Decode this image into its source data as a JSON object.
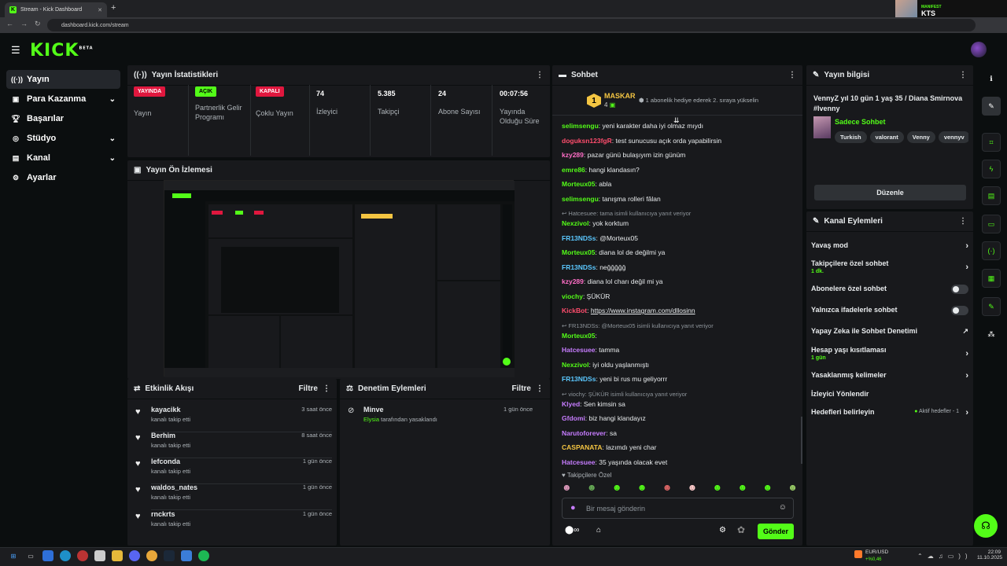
{
  "browser": {
    "tab_title": "Stream - Kick Dashboard",
    "url": "dashboard.kick.com/stream",
    "now_playing_label": "MANIFEST",
    "now_playing_name": "KTS"
  },
  "brand": {
    "logo": "KICK",
    "beta": "BETA",
    "accent": "#53fc18"
  },
  "sidebar": {
    "items": [
      {
        "label": "Yayın",
        "icon": "broadcast-icon"
      },
      {
        "label": "Para Kazanma",
        "icon": "money-icon"
      },
      {
        "label": "Başarılar",
        "icon": "trophy-icon"
      },
      {
        "label": "Stüdyo",
        "icon": "studio-icon"
      },
      {
        "label": "Kanal",
        "icon": "channel-icon"
      },
      {
        "label": "Ayarlar",
        "icon": "gear-icon"
      }
    ]
  },
  "stats": {
    "title": "Yayın İstatistikleri",
    "items": [
      {
        "badge": "YAYINDA",
        "label": "Yayın"
      },
      {
        "badge": "AÇIK",
        "label": "Partnerlik Gelir Programı"
      },
      {
        "badge": "KAPALI",
        "label": "Çoklu Yayın"
      },
      {
        "value": "74",
        "label": "İzleyici"
      },
      {
        "value": "5.385",
        "label": "Takipçi"
      },
      {
        "value": "24",
        "label": "Abone Sayısı"
      },
      {
        "value": "00:07:56",
        "label": "Yayında Olduğu Süre"
      }
    ]
  },
  "preview": {
    "title": "Yayın Ön İzlemesi"
  },
  "activity": {
    "title": "Etkinlik Akışı",
    "filter": "Filtre",
    "items": [
      {
        "name": "kayacikk",
        "sub": "kanalı takip etti",
        "time": "3 saat önce"
      },
      {
        "name": "Berhim",
        "sub": "kanalı takip etti",
        "time": "8 saat önce"
      },
      {
        "name": "lefconda",
        "sub": "kanalı takip etti",
        "time": "1 gün önce"
      },
      {
        "name": "waldos_nates",
        "sub": "kanalı takip etti",
        "time": "1 gün önce"
      },
      {
        "name": "rnckrts",
        "sub": "kanalı takip etti",
        "time": "1 gün önce"
      }
    ]
  },
  "moderation": {
    "title": "Denetim Eylemleri",
    "filter": "Filtre",
    "item": {
      "name": "Minve",
      "actor": "Elysia",
      "action": "tarafından yasaklandı",
      "time": "1 gün önce"
    }
  },
  "chat": {
    "title": "Sohbet",
    "pinned_name": "MASKAR",
    "pinned_count": "4",
    "pinned_rank": "1",
    "pinned_text": "1 abonelik hediye ederek 2. sıraya yükselin",
    "messages": [
      {
        "user": "selimsengu",
        "color": "#53fc18",
        "text": "yeni karakter daha iyi olmaz mıydı"
      },
      {
        "user": "doguksn123fgR",
        "color": "#ff4d6d",
        "text": "test sunucusu açık orda yapabilirsin"
      },
      {
        "user": "kzy289",
        "color": "#ff6ec7",
        "text": "pazar günü bulaşıyım izin günüm"
      },
      {
        "user": "emre86",
        "color": "#53fc18",
        "text": "hangi klandasın?"
      },
      {
        "user": "Morteux05",
        "color": "#53fc18",
        "text": "abla"
      },
      {
        "user": "selimsengu",
        "color": "#53fc18",
        "text": "tanışma rolleri fâlan"
      },
      {
        "reply": "Hatcesuee: tama isimli kullanıcıya yanıt veriyor"
      },
      {
        "user": "Nexzivol",
        "color": "#53fc18",
        "text": "yok korktum"
      },
      {
        "user": "FR13NDSs",
        "color": "#5bc8ff",
        "text": "@Morteux05"
      },
      {
        "user": "Morteux05",
        "color": "#53fc18",
        "text": "diana lol de değilmi ya"
      },
      {
        "user": "FR13NDSs",
        "color": "#5bc8ff",
        "text": "neğğğğğ"
      },
      {
        "user": "kzy289",
        "color": "#ff6ec7",
        "text": "diana lol charı değil mi ya"
      },
      {
        "user": "viochy",
        "color": "#53fc18",
        "text": "ŞÜKÜR"
      },
      {
        "user": "KickBot",
        "color": "#ff4d6d",
        "text": "https://www.instagram.com/dllosinn"
      },
      {
        "reply": "FR13NDSs: @Morteux05 isimli kullanıcıya yanıt veriyor"
      },
      {
        "user": "Morteux05",
        "color": "#53fc18",
        "text": ""
      },
      {
        "user": "Hatcesuee",
        "color": "#c77dff",
        "text": "tamma"
      },
      {
        "user": "Nexzivol",
        "color": "#53fc18",
        "text": "iyi oldu yaşlanmıştı"
      },
      {
        "user": "FR13NDSs",
        "color": "#5bc8ff",
        "text": "yeni bi rus mu geliyorrr"
      },
      {
        "reply": "viochy: ŞÜKÜR isimli kullanıcıya yanıt veriyor"
      },
      {
        "user": "Klyed",
        "color": "#c77dff",
        "text": "Sen kimsin sa"
      },
      {
        "user": "Gfdomi",
        "color": "#c77dff",
        "text": "biz hangi klandayız"
      },
      {
        "user": "Narutoforever",
        "color": "#c77dff",
        "text": "sa"
      },
      {
        "user": "CASPANATA",
        "color": "#f4c542",
        "text": "lazımdı yeni char"
      },
      {
        "user": "Hatcesuee",
        "color": "#c77dff",
        "text": "35 yaşında olacak evet"
      }
    ],
    "emote_section": "Takipçilere Özel",
    "input_placeholder": "Bir mesaj gönderin",
    "send_label": "Gönder"
  },
  "stream_info": {
    "title": "Yayın bilgisi",
    "stream_title": "VennyZ yıl 10 gün 1 yaş 35 / Diana Smirnova #Ivenny",
    "category": "Sadece Sohbet",
    "tags": [
      "Turkish",
      "valorant",
      "Venny",
      "vennyv"
    ],
    "edit_label": "Düzenle"
  },
  "channel_actions": {
    "title": "Kanal Eylemleri",
    "items": [
      {
        "label": "Yavaş mod",
        "control": "arrow"
      },
      {
        "label": "Takipçilere özel sohbet",
        "sub": "1 dk.",
        "control": "arrow"
      },
      {
        "label": "Abonelere özel sohbet",
        "control": "toggle"
      },
      {
        "label": "Yalnızca ifadelerle sohbet",
        "control": "toggle"
      },
      {
        "label": "Yapay Zeka ile Sohbet Denetimi",
        "control": "external"
      },
      {
        "label": "Hesap yaşı kısıtlaması",
        "sub": "1 gün",
        "control": "arrow"
      },
      {
        "label": "Yasaklanmış kelimeler",
        "control": "arrow"
      },
      {
        "label": "İzleyici Yönlendir",
        "control": "none"
      },
      {
        "label": "Hedefleri belirleyin",
        "status": "Aktif hedefler - 1",
        "control": "arrow"
      }
    ]
  },
  "taskbar": {
    "ticker_name": "EUR/USD",
    "ticker_change": "+%0,46",
    "time": "22:09",
    "date": "11.10.2025"
  }
}
